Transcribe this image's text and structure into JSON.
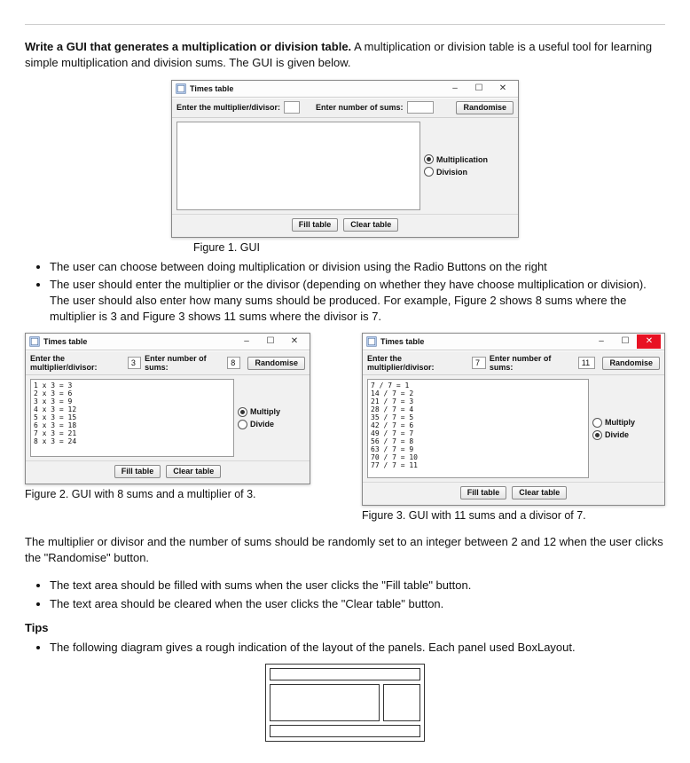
{
  "doc": {
    "intro_bold": "Write a GUI that generates a multiplication or division table.",
    "intro_rest": " A multiplication or division table is a useful tool for learning simple multiplication and division sums. The GUI is given below.",
    "fig1_cap": "Figure 1. GUI",
    "bullets1_a": "The user can choose between doing multiplication or division using the Radio Buttons on the right",
    "bullets1_b": "The user should enter the multiplier or the divisor (depending on whether they have choose multiplication or division). The user should also enter how many sums should be produced. For example, Figure 2 shows 8 sums where the multiplier is 3 and Figure 3 shows 11 sums where the divisor is 7.",
    "fig2_cap": "Figure 2. GUI with 8 sums and a multiplier of 3.",
    "fig3_cap": "Figure 3. GUI with 11 sums and a divisor of 7.",
    "para_random": "The multiplier or divisor and the number of sums should be randomly set to an integer between 2 and 12 when the user clicks the \"Randomise\" button.",
    "bullets2_a": "The text area should be filled with sums when the user clicks the \"Fill table\" button.",
    "bullets2_b": "The text area should be cleared when the user clicks the \"Clear table\" button.",
    "tips_head": "Tips",
    "tip1": "The following diagram gives a rough indication of the layout of the panels. Each panel used BoxLayout."
  },
  "labels": {
    "title": "Times table",
    "multi_div": "Enter the multiplier/divisor:",
    "nsums": "Enter number of sums:",
    "randomise": "Randomise",
    "fill": "Fill table",
    "clear": "Clear table",
    "r_mul_long": "Multiplication",
    "r_div_long": "Division",
    "r_mul_short": "Multiply",
    "r_div_short": "Divide"
  },
  "fig1": {
    "mult_val": "",
    "sums_val": "",
    "textarea": "",
    "close_red": false
  },
  "fig2": {
    "mult_val": "3",
    "sums_val": "8",
    "textarea": "1 x 3 = 3\n2 x 3 = 6\n3 x 3 = 9\n4 x 3 = 12\n5 x 3 = 15\n6 x 3 = 18\n7 x 3 = 21\n8 x 3 = 24",
    "selected": "mul",
    "close_red": false
  },
  "fig3": {
    "mult_val": "7",
    "sums_val": "11",
    "textarea": "7 / 7 = 1\n14 / 7 = 2\n21 / 7 = 3\n28 / 7 = 4\n35 / 7 = 5\n42 / 7 = 6\n49 / 7 = 7\n56 / 7 = 8\n63 / 7 = 9\n70 / 7 = 10\n77 / 7 = 11",
    "selected": "div",
    "close_red": true
  }
}
